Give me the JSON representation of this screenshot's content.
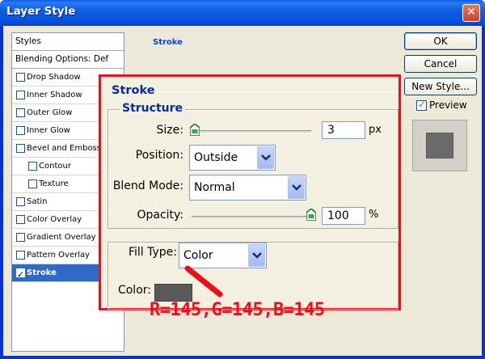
{
  "window": {
    "title": "Layer Style",
    "close_glyph": "✕"
  },
  "styles_list": {
    "header": "Styles",
    "blending": "Blending Options: Def",
    "items": [
      {
        "label": "Drop Shadow",
        "checked": false,
        "indent": false
      },
      {
        "label": "Inner Shadow",
        "checked": false,
        "indent": false
      },
      {
        "label": "Outer Glow",
        "checked": false,
        "indent": false
      },
      {
        "label": "Inner Glow",
        "checked": false,
        "indent": false
      },
      {
        "label": "Bevel and Emboss",
        "checked": false,
        "indent": false
      },
      {
        "label": "Contour",
        "checked": false,
        "indent": true
      },
      {
        "label": "Texture",
        "checked": false,
        "indent": true
      },
      {
        "label": "Satin",
        "checked": false,
        "indent": false
      },
      {
        "label": "Color Overlay",
        "checked": false,
        "indent": false
      },
      {
        "label": "Gradient Overlay",
        "checked": false,
        "indent": false
      },
      {
        "label": "Pattern Overlay",
        "checked": false,
        "indent": false
      },
      {
        "label": "Stroke",
        "checked": true,
        "indent": false,
        "selected": true
      }
    ]
  },
  "background_panel": {
    "group_title": "Stroke"
  },
  "buttons": {
    "ok": "OK",
    "cancel": "Cancel",
    "new_style": "New Style...",
    "preview": "Preview"
  },
  "stroke": {
    "title": "Stroke",
    "structure": "Structure",
    "size_label": "Size:",
    "size_value": "3",
    "size_unit": "px",
    "position_label": "Position:",
    "position_value": "Outside",
    "blend_label": "Blend Mode:",
    "blend_value": "Normal",
    "opacity_label": "Opacity:",
    "opacity_value": "100",
    "opacity_unit": "%",
    "fill_type_label": "Fill Type:",
    "fill_type_value": "Color",
    "color_label": "Color:"
  },
  "annotation": "R=145,G=145,B=145",
  "colors": {
    "stroke_color": "#595959",
    "annotation": "#e8101a",
    "highlight": "#e0141e"
  }
}
